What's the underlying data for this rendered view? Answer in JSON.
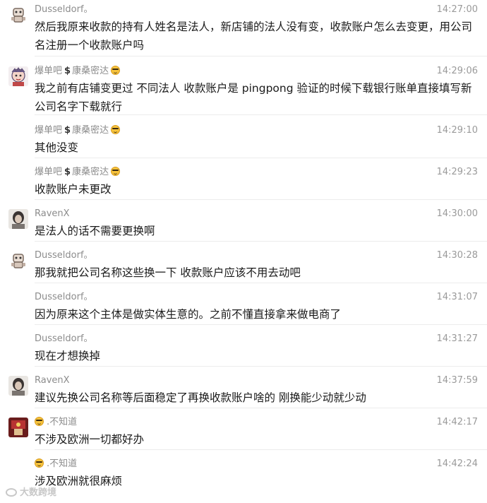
{
  "messages": [
    {
      "sender": "Dusseldorf。",
      "time": "14:27:00",
      "text": "然后我原来收款的持有人姓名是法人，新店铺的法人没有变，收款账户怎么去变更，用公司名注册一个收款账户吗",
      "avatar": "robot-avatar"
    },
    {
      "sender": "爆单吧",
      "sender2": "康桑密达",
      "time": "14:29:06",
      "text": "我之前有店铺变更过  不同法人  收款账户是 pingpong  验证的时候下载银行账单直接填写新公司名字下载就行",
      "avatar": "cartoon-avatar"
    },
    {
      "sender": "爆单吧",
      "sender2": "康桑密达",
      "time": "14:29:10",
      "text": "其他没变"
    },
    {
      "sender": "爆单吧",
      "sender2": "康桑密达",
      "time": "14:29:23",
      "text": "收款账户未更改"
    },
    {
      "sender": "RavenX",
      "time": "14:30:00",
      "text": "是法人的话不需要更换啊",
      "avatar": "photo-avatar"
    },
    {
      "sender": "Dusseldorf。",
      "time": "14:30:28",
      "text": "那我就把公司名称这些换一下 收款账户应该不用去动吧",
      "avatar": "robot-avatar"
    },
    {
      "sender": "Dusseldorf。",
      "time": "14:31:07",
      "text": "因为原来这个主体是做实体生意的。之前不懂直接拿来做电商了"
    },
    {
      "sender": "Dusseldorf。",
      "time": "14:31:27",
      "text": "现在才想换掉"
    },
    {
      "sender": "RavenX",
      "time": "14:37:59",
      "text": "建议先换公司名称等后面稳定了再换收款账户啥的 刚换能少动就少动",
      "avatar": "photo-avatar"
    },
    {
      "sender": ".不知道",
      "time": "14:42:17",
      "text": "不涉及欧洲一切都好办",
      "avatar": "red-avatar"
    },
    {
      "sender": ".不知道",
      "time": "14:42:24",
      "text": "涉及欧洲就很麻烦"
    }
  ],
  "watermark": "大数跨境",
  "colors": {
    "background": "#ffffff",
    "text": "#1a1a1a",
    "meta": "#8c8c8c",
    "divider": "#ececec"
  }
}
